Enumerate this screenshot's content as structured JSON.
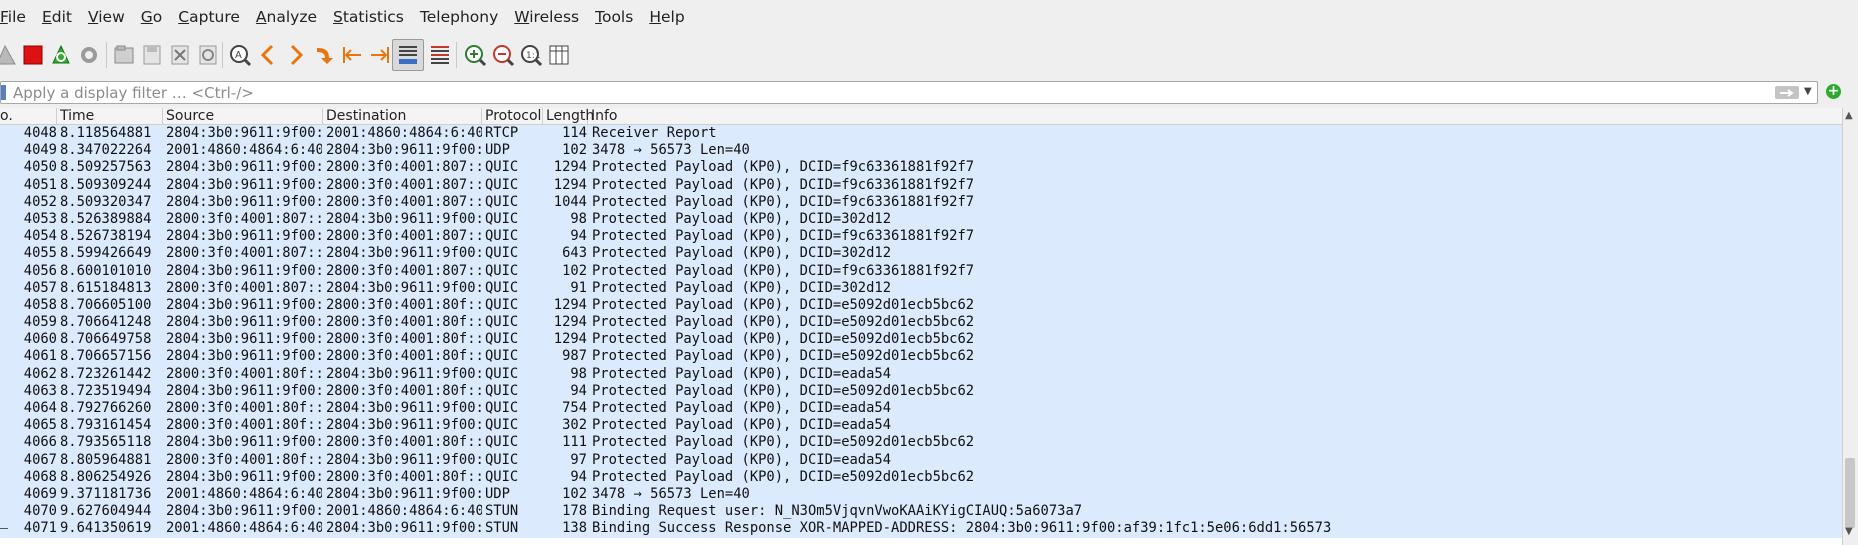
{
  "menu": [
    {
      "label": "File",
      "ul": "F",
      "rest": "ile"
    },
    {
      "label": "Edit",
      "ul": "E",
      "rest": "dit"
    },
    {
      "label": "View",
      "ul": "V",
      "rest": "iew"
    },
    {
      "label": "Go",
      "ul": "G",
      "rest": "o"
    },
    {
      "label": "Capture",
      "ul": "C",
      "rest": "apture"
    },
    {
      "label": "Analyze",
      "ul": "A",
      "rest": "nalyze"
    },
    {
      "label": "Statistics",
      "ul": "S",
      "rest": "tatistics"
    },
    {
      "label": "Telephony",
      "ul": "",
      "rest": "Telephony"
    },
    {
      "label": "Wireless",
      "ul": "W",
      "rest": "ireless"
    },
    {
      "label": "Tools",
      "ul": "T",
      "rest": "ools"
    },
    {
      "label": "Help",
      "ul": "H",
      "rest": "elp"
    }
  ],
  "toolbar_icons": [
    "shark-fin-start-icon",
    "stop-capture-icon",
    "restart-capture-icon",
    "capture-options-icon",
    "open-file-icon",
    "save-file-icon",
    "close-file-icon",
    "reload-file-icon",
    "find-packet-icon",
    "go-back-icon",
    "go-forward-icon",
    "go-to-packet-icon",
    "first-packet-icon",
    "last-packet-icon",
    "auto-scroll-icon",
    "colorize-icon",
    "zoom-in-icon",
    "zoom-out-icon",
    "normal-size-icon",
    "resize-columns-icon"
  ],
  "filter": {
    "placeholder": "Apply a display filter … <Ctrl-/>"
  },
  "columns": {
    "no": "o.",
    "time": "Time",
    "source": "Source",
    "destination": "Destination",
    "protocol": "Protocol",
    "length": "Length",
    "info": "Info"
  },
  "colors": {
    "row_bg": "#dbeafd",
    "stop_red": "#dd1111",
    "shark_green": "#2eab2e",
    "arrow_orange": "#e8760d"
  },
  "packets": [
    {
      "no": "4048",
      "time": "8.118564881",
      "src": "2804:3b0:9611:9f00:…",
      "dst": "2001:4860:4864:6:40…",
      "proto": "RTCP",
      "len": "114",
      "info": "Receiver Report"
    },
    {
      "no": "4049",
      "time": "8.347022264",
      "src": "2001:4860:4864:6:40…",
      "dst": "2804:3b0:9611:9f00:…",
      "proto": "UDP",
      "len": "102",
      "info": "3478 → 56573 Len=40"
    },
    {
      "no": "4050",
      "time": "8.509257563",
      "src": "2804:3b0:9611:9f00:…",
      "dst": "2800:3f0:4001:807::…",
      "proto": "QUIC",
      "len": "1294",
      "info": "Protected Payload (KP0), DCID=f9c63361881f92f7"
    },
    {
      "no": "4051",
      "time": "8.509309244",
      "src": "2804:3b0:9611:9f00:…",
      "dst": "2800:3f0:4001:807::…",
      "proto": "QUIC",
      "len": "1294",
      "info": "Protected Payload (KP0), DCID=f9c63361881f92f7"
    },
    {
      "no": "4052",
      "time": "8.509320347",
      "src": "2804:3b0:9611:9f00:…",
      "dst": "2800:3f0:4001:807::…",
      "proto": "QUIC",
      "len": "1044",
      "info": "Protected Payload (KP0), DCID=f9c63361881f92f7"
    },
    {
      "no": "4053",
      "time": "8.526389884",
      "src": "2800:3f0:4001:807::…",
      "dst": "2804:3b0:9611:9f00:…",
      "proto": "QUIC",
      "len": "98",
      "info": "Protected Payload (KP0), DCID=302d12"
    },
    {
      "no": "4054",
      "time": "8.526738194",
      "src": "2804:3b0:9611:9f00:…",
      "dst": "2800:3f0:4001:807::…",
      "proto": "QUIC",
      "len": "94",
      "info": "Protected Payload (KP0), DCID=f9c63361881f92f7"
    },
    {
      "no": "4055",
      "time": "8.599426649",
      "src": "2800:3f0:4001:807::…",
      "dst": "2804:3b0:9611:9f00:…",
      "proto": "QUIC",
      "len": "643",
      "info": "Protected Payload (KP0), DCID=302d12"
    },
    {
      "no": "4056",
      "time": "8.600101010",
      "src": "2804:3b0:9611:9f00:…",
      "dst": "2800:3f0:4001:807::…",
      "proto": "QUIC",
      "len": "102",
      "info": "Protected Payload (KP0), DCID=f9c63361881f92f7"
    },
    {
      "no": "4057",
      "time": "8.615184813",
      "src": "2800:3f0:4001:807::…",
      "dst": "2804:3b0:9611:9f00:…",
      "proto": "QUIC",
      "len": "91",
      "info": "Protected Payload (KP0), DCID=302d12"
    },
    {
      "no": "4058",
      "time": "8.706605100",
      "src": "2804:3b0:9611:9f00:…",
      "dst": "2800:3f0:4001:80f::…",
      "proto": "QUIC",
      "len": "1294",
      "info": "Protected Payload (KP0), DCID=e5092d01ecb5bc62"
    },
    {
      "no": "4059",
      "time": "8.706641248",
      "src": "2804:3b0:9611:9f00:…",
      "dst": "2800:3f0:4001:80f::…",
      "proto": "QUIC",
      "len": "1294",
      "info": "Protected Payload (KP0), DCID=e5092d01ecb5bc62"
    },
    {
      "no": "4060",
      "time": "8.706649758",
      "src": "2804:3b0:9611:9f00:…",
      "dst": "2800:3f0:4001:80f::…",
      "proto": "QUIC",
      "len": "1294",
      "info": "Protected Payload (KP0), DCID=e5092d01ecb5bc62"
    },
    {
      "no": "4061",
      "time": "8.706657156",
      "src": "2804:3b0:9611:9f00:…",
      "dst": "2800:3f0:4001:80f::…",
      "proto": "QUIC",
      "len": "987",
      "info": "Protected Payload (KP0), DCID=e5092d01ecb5bc62"
    },
    {
      "no": "4062",
      "time": "8.723261442",
      "src": "2800:3f0:4001:80f::…",
      "dst": "2804:3b0:9611:9f00:…",
      "proto": "QUIC",
      "len": "98",
      "info": "Protected Payload (KP0), DCID=eada54"
    },
    {
      "no": "4063",
      "time": "8.723519494",
      "src": "2804:3b0:9611:9f00:…",
      "dst": "2800:3f0:4001:80f::…",
      "proto": "QUIC",
      "len": "94",
      "info": "Protected Payload (KP0), DCID=e5092d01ecb5bc62"
    },
    {
      "no": "4064",
      "time": "8.792766260",
      "src": "2800:3f0:4001:80f::…",
      "dst": "2804:3b0:9611:9f00:…",
      "proto": "QUIC",
      "len": "754",
      "info": "Protected Payload (KP0), DCID=eada54"
    },
    {
      "no": "4065",
      "time": "8.793161454",
      "src": "2800:3f0:4001:80f::…",
      "dst": "2804:3b0:9611:9f00:…",
      "proto": "QUIC",
      "len": "302",
      "info": "Protected Payload (KP0), DCID=eada54"
    },
    {
      "no": "4066",
      "time": "8.793565118",
      "src": "2804:3b0:9611:9f00:…",
      "dst": "2800:3f0:4001:80f::…",
      "proto": "QUIC",
      "len": "111",
      "info": "Protected Payload (KP0), DCID=e5092d01ecb5bc62"
    },
    {
      "no": "4067",
      "time": "8.805964881",
      "src": "2800:3f0:4001:80f::…",
      "dst": "2804:3b0:9611:9f00:…",
      "proto": "QUIC",
      "len": "97",
      "info": "Protected Payload (KP0), DCID=eada54"
    },
    {
      "no": "4068",
      "time": "8.806254926",
      "src": "2804:3b0:9611:9f00:…",
      "dst": "2800:3f0:4001:80f::…",
      "proto": "QUIC",
      "len": "94",
      "info": "Protected Payload (KP0), DCID=e5092d01ecb5bc62"
    },
    {
      "no": "4069",
      "time": "9.371181736",
      "src": "2001:4860:4864:6:40…",
      "dst": "2804:3b0:9611:9f00:…",
      "proto": "UDP",
      "len": "102",
      "info": "3478 → 56573 Len=40"
    },
    {
      "no": "4070",
      "time": "9.627604944",
      "src": "2804:3b0:9611:9f00:…",
      "dst": "2001:4860:4864:6:40…",
      "proto": "STUN",
      "len": "178",
      "info": "Binding Request user: N_N3Om5VjqvnVwoKAAiKYigCIAUQ:5a6073a7"
    },
    {
      "no": "4071",
      "time": "9.641350619",
      "src": "2001:4860:4864:6:40…",
      "dst": "2804:3b0:9611:9f00:…",
      "proto": "STUN",
      "len": "138",
      "info": "Binding Success Response XOR-MAPPED-ADDRESS: 2804:3b0:9611:9f00:af39:1fc1:5e06:6dd1:56573"
    }
  ]
}
